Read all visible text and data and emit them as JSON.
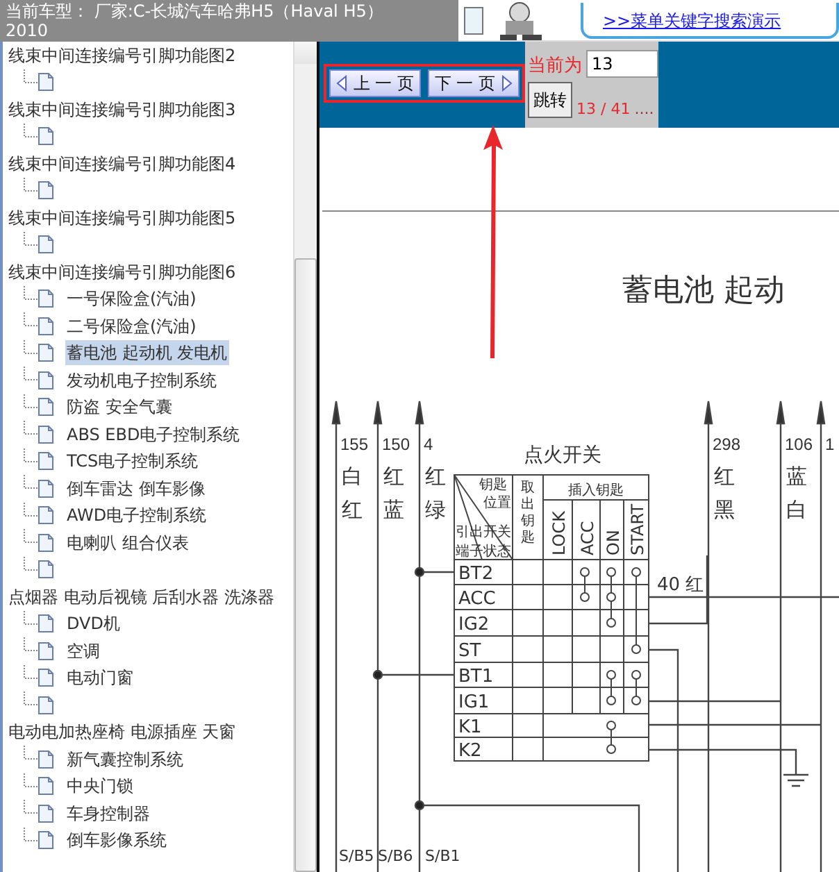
{
  "header": {
    "title": "当前车型： 厂家:C-长城汽车哈弗H5（Haval H5）",
    "year": "2010"
  },
  "banner": {
    "link": ">>菜单关键字搜索演示"
  },
  "tree": [
    {
      "label": "线束中间连接编号引脚功能图2",
      "selected": false,
      "children": [
        {
          "selected": false
        }
      ]
    },
    {
      "label": "线束中间连接编号引脚功能图3",
      "selected": false,
      "children": [
        {
          "selected": false
        }
      ]
    },
    {
      "label": "线束中间连接编号引脚功能图4",
      "selected": false,
      "children": [
        {
          "selected": false
        }
      ]
    },
    {
      "label": "线束中间连接编号引脚功能图5",
      "selected": false,
      "children": [
        {
          "selected": false
        }
      ]
    },
    {
      "label": "线束中间连接编号引脚功能图6",
      "selected": false,
      "children": [
        {
          "label": "一号保险盒(汽油)",
          "selected": false
        },
        {
          "label": "二号保险盒(汽油)",
          "selected": false
        },
        {
          "label": "蓄电池 起动机 发电机",
          "selected": true
        },
        {
          "label": "发动机电子控制系统",
          "selected": false
        },
        {
          "label": "防盗 安全气囊",
          "selected": false
        },
        {
          "label": "ABS EBD电子控制系统",
          "selected": false
        },
        {
          "label": "TCS电子控制系统",
          "selected": false
        },
        {
          "label": "倒车雷达 倒车影像",
          "selected": false
        },
        {
          "label": "AWD电子控制系统",
          "selected": false
        },
        {
          "label": "电喇叭 组合仪表",
          "selected": false
        },
        {
          "selected": false
        }
      ]
    },
    {
      "label": "点烟器 电动后视镜 后刮水器 洗涤器",
      "selected": false,
      "children": [
        {
          "label": "DVD机",
          "selected": false
        },
        {
          "label": "空调",
          "selected": false
        },
        {
          "label": "电动门窗",
          "selected": false
        },
        {
          "selected": false
        }
      ]
    },
    {
      "label": "电动电加热座椅 电源插座 天窗",
      "selected": false,
      "children": [
        {
          "label": "新气囊控制系统",
          "selected": false
        },
        {
          "label": "中央门锁",
          "selected": false
        },
        {
          "label": "车身控制器",
          "selected": false
        },
        {
          "label": "倒车影像系统",
          "selected": false
        }
      ]
    }
  ],
  "pager": {
    "prev": "上 一 页",
    "next": "下 一 页",
    "current_label": "当前为",
    "page_input": "13",
    "jump": "跳转",
    "page_count": "13 / 41",
    "ellipsis": "...."
  },
  "diagram": {
    "title": "蓄电池 起动",
    "switch_title": "点火开关",
    "corner_labels": [
      "钥匙",
      "位置",
      "引出",
      "开关",
      "端子",
      "状态"
    ],
    "remove_key": "取出钥匙",
    "insert_key": "插入钥匙",
    "positions": [
      "LOCK",
      "ACC",
      "ON",
      "START"
    ],
    "terminals": [
      "BT2",
      "ACC",
      "IG2",
      "ST",
      "BT1",
      "IG1",
      "K1",
      "K2"
    ],
    "wires": [
      {
        "number": "155",
        "colors": [
          "白",
          "红"
        ]
      },
      {
        "number": "150",
        "colors": [
          "红",
          "蓝"
        ]
      },
      {
        "number": "4",
        "colors": [
          "红",
          "绿"
        ]
      },
      {
        "number": "298",
        "colors": [
          "红",
          "黑"
        ]
      },
      {
        "number": "106",
        "colors": [
          "蓝",
          "白"
        ]
      },
      {
        "number": "1"
      }
    ],
    "output_label": "40 红",
    "fuses": [
      "S/B5",
      "S/B6",
      "S/B1"
    ]
  }
}
